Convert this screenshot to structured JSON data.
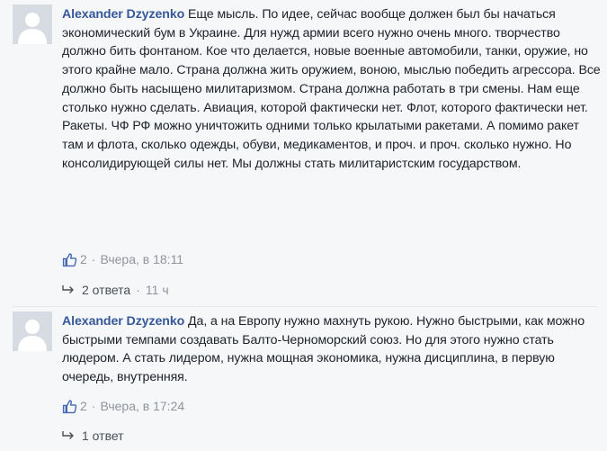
{
  "comments": [
    {
      "author": "Alexander Dzyzenko",
      "text": "Еще мысль. По идее, сейчас вообще должен был бы начаться экономический бум в Украине. Для нужд армии всего нужно очень много. творчество должно бить фонтаном. Кое что делается, новые военные автомобили, танки, оружие, но этого крайне мало. Страна должна жить оружием, воною, мыслью победить агрессора. Все должно быть насыщено милитаризмом. Страна должна работать в три смены. Нам еще столько нужно сделать. Авиация, которой фактически нет. Флот, которого фактически нет. Ракеты. ЧФ РФ можно уничтожить одними только крылатыми ракетами. А помимо ракет там и флота, сколько одежды, обуви, медикаментов, и проч. и проч. сколько нужно. Но консолидирующей силы нет. Мы должны стать милитаристским государством.",
      "likes": "2",
      "separator": "·",
      "timestamp": "Вчера, в 18:11",
      "replies_label": "2 ответа",
      "replies_time": "11 ч"
    },
    {
      "author": "Alexander Dzyzenko",
      "text": "Да, а на Европу нужно махнуть рукою. Нужно быстрыми, как можно быстрыми темпами создавать Балто-Черноморский союз. Но для этого нужно стать людером. А стать лидером, нужна мощная экономика, нужна дисциплина, в первую очередь, внутренняя.",
      "likes": "2",
      "separator": "·",
      "timestamp": "Вчера, в 17:24",
      "replies_label": "1 ответ"
    }
  ],
  "colors": {
    "author": "#365899",
    "meta": "#90949c",
    "like": "#4267b2",
    "background": "#f6f7f9"
  },
  "icons": [
    "default-avatar-icon",
    "like-thumb-icon",
    "reply-arrow-icon"
  ]
}
